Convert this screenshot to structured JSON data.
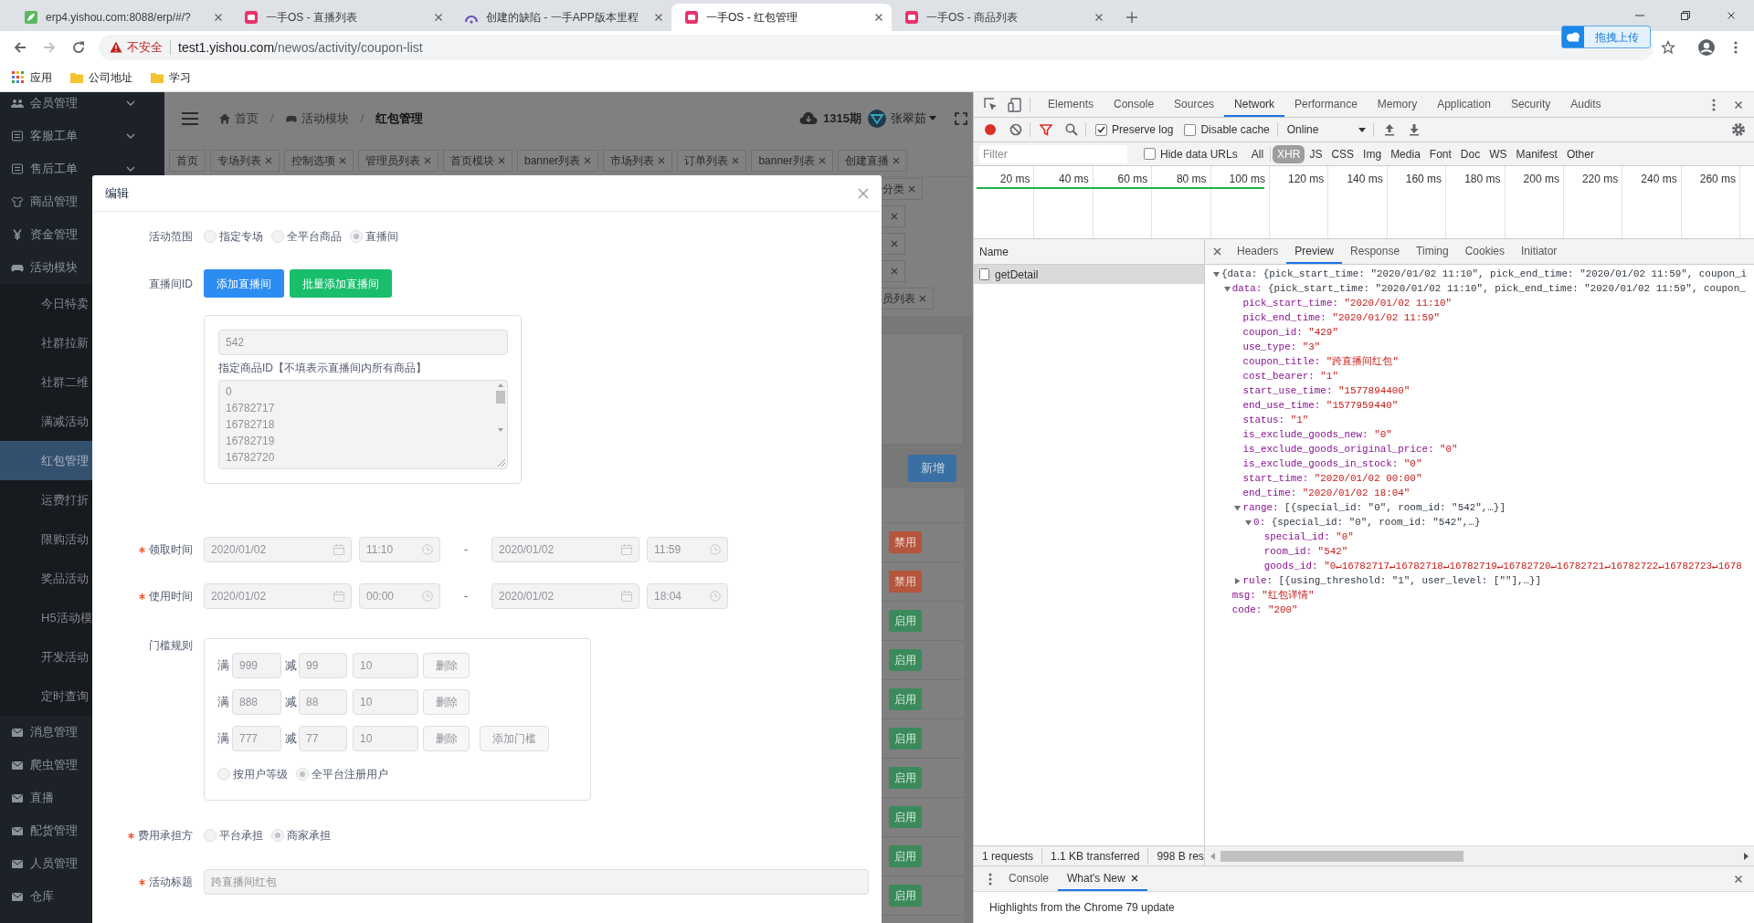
{
  "browser": {
    "tabs": [
      {
        "title": "erp4.yishou.com:8088/erp/#/?",
        "selected": false
      },
      {
        "title": "一手OS - 直播列表",
        "selected": false
      },
      {
        "title": "创建的缺陷 - 一手APP版本里程",
        "selected": false
      },
      {
        "title": "一手OS - 红包管理",
        "selected": true
      },
      {
        "title": "一手OS - 商品列表",
        "selected": false
      }
    ],
    "address": {
      "security": "不安全",
      "host": "test1.yishou.com",
      "path": "/newos/activity/coupon-list"
    },
    "upload_widget": "拖拽上传",
    "bookmarks": [
      {
        "label": "应用",
        "kind": "apps"
      },
      {
        "label": "公司地址",
        "kind": "folder"
      },
      {
        "label": "学习",
        "kind": "folder"
      }
    ]
  },
  "sidebar": {
    "items": [
      {
        "label": "会员管理",
        "expanded": false
      },
      {
        "label": "客服工单",
        "expanded": false
      },
      {
        "label": "售后工单",
        "expanded": false
      },
      {
        "label": "商品管理"
      },
      {
        "label": "资金管理"
      },
      {
        "label": "活动模块",
        "expanded": true,
        "children": [
          {
            "label": "今日特卖",
            "selected": false
          },
          {
            "label": "社群拉新",
            "selected": false
          },
          {
            "label": "社群二维",
            "selected": false
          },
          {
            "label": "满减活动",
            "selected": false
          },
          {
            "label": "红包管理",
            "selected": true
          },
          {
            "label": "运费打折",
            "selected": false
          },
          {
            "label": "限购活动",
            "selected": false
          },
          {
            "label": "奖品活动",
            "selected": false
          },
          {
            "label": "H5活动模",
            "selected": false
          },
          {
            "label": "开发活动",
            "selected": false
          },
          {
            "label": "定时查询",
            "selected": false
          }
        ]
      },
      {
        "label": "消息管理"
      },
      {
        "label": "爬虫管理"
      },
      {
        "label": "直播"
      },
      {
        "label": "配货管理"
      },
      {
        "label": "人员管理"
      },
      {
        "label": "仓库"
      }
    ]
  },
  "header": {
    "breadcrumb": [
      {
        "label": "首页",
        "separator": "/"
      },
      {
        "label": "活动模块",
        "separator": "/"
      },
      {
        "label": "红包管理"
      }
    ],
    "period": "1315期",
    "user": "张翠茹"
  },
  "tags": [
    {
      "label": "首页",
      "closable": false
    },
    {
      "label": "专场列表",
      "closable": true
    },
    {
      "label": "控制选项",
      "closable": true
    },
    {
      "label": "管理员列表",
      "closable": true
    },
    {
      "label": "首页模块",
      "closable": true
    },
    {
      "label": "banner列表",
      "closable": true
    },
    {
      "label": "市场列表",
      "closable": true
    },
    {
      "label": "订单列表",
      "closable": true
    },
    {
      "label": "banner列表",
      "closable": true
    },
    {
      "label": "创建直播",
      "closable": true
    }
  ],
  "tag_fragments": [
    {
      "label": "分类",
      "closable": true
    },
    {
      "closable": true
    },
    {
      "closable": true
    },
    {
      "closable": true
    },
    {
      "label": "员列表",
      "closable": true
    }
  ],
  "new_button": "新增",
  "status_buttons": [
    {
      "label": "禁用",
      "kind": "disable"
    },
    {
      "label": "禁用",
      "kind": "disable"
    },
    {
      "label": "启用",
      "kind": "enable"
    },
    {
      "label": "启用",
      "kind": "enable"
    },
    {
      "label": "启用",
      "kind": "enable"
    },
    {
      "label": "启用",
      "kind": "enable"
    },
    {
      "label": "启用",
      "kind": "enable"
    },
    {
      "label": "启用",
      "kind": "enable"
    },
    {
      "label": "启用",
      "kind": "enable"
    },
    {
      "label": "启用",
      "kind": "enable"
    }
  ],
  "modal": {
    "title": "编辑",
    "scope": {
      "label": "活动范围",
      "options": [
        {
          "label": "指定专场",
          "selected": false
        },
        {
          "label": "全平台商品",
          "selected": false
        },
        {
          "label": "直播间",
          "selected": true
        }
      ]
    },
    "room": {
      "label": "直播间ID",
      "buttons": [
        {
          "label": "添加直播间",
          "kind": "primary"
        },
        {
          "label": "批量添加直播间",
          "kind": "success"
        }
      ],
      "room_id": "542",
      "goods_hint": "指定商品ID【不填表示直播间内所有商品】",
      "goods_ids": [
        "0",
        "16782717",
        "16782718",
        "16782719",
        "16782720"
      ]
    },
    "pick_time": {
      "label": "领取时间",
      "required": true,
      "start_date": "2020/01/02",
      "start_time": "11:10",
      "separator": "-",
      "end_date": "2020/01/02",
      "end_time": "11:59"
    },
    "use_time": {
      "label": "使用时间",
      "required": true,
      "start_date": "2020/01/02",
      "start_time": "00:00",
      "separator": "-",
      "end_date": "2020/01/02",
      "end_time": "18:04"
    },
    "threshold": {
      "label": "门槛规则",
      "rows": [
        {
          "full_label": "满",
          "full": "999",
          "minus_label": "减",
          "minus": "99",
          "count": "10",
          "delete": "删除"
        },
        {
          "full_label": "满",
          "full": "888",
          "minus_label": "减",
          "minus": "88",
          "count": "10",
          "delete": "删除"
        },
        {
          "full_label": "满",
          "full": "777",
          "minus_label": "减",
          "minus": "77",
          "count": "10",
          "delete": "删除"
        }
      ],
      "add_button": "添加门槛",
      "levels": [
        {
          "label": "按用户等级",
          "selected": false
        },
        {
          "label": "全平台注册用户",
          "selected": true
        }
      ]
    },
    "cost_bearer": {
      "label": "费用承担方",
      "required": true,
      "options": [
        {
          "label": "平台承担",
          "selected": false
        },
        {
          "label": "商家承担",
          "selected": true
        }
      ]
    },
    "activity_title": {
      "label": "活动标题",
      "required": true,
      "value": "跨直播间红包"
    }
  },
  "devtools": {
    "panel_tabs": [
      {
        "label": "Elements",
        "selected": false
      },
      {
        "label": "Console",
        "selected": false
      },
      {
        "label": "Sources",
        "selected": false
      },
      {
        "label": "Network",
        "selected": true
      },
      {
        "label": "Performance",
        "selected": false
      },
      {
        "label": "Memory",
        "selected": false
      },
      {
        "label": "Application",
        "selected": false
      },
      {
        "label": "Security",
        "selected": false
      },
      {
        "label": "Audits",
        "selected": false
      }
    ],
    "preserve_log": {
      "label": "Preserve log",
      "checked": true
    },
    "disable_cache": {
      "label": "Disable cache",
      "checked": false
    },
    "throttling": "Online",
    "filter_placeholder": "Filter",
    "hide_data_urls": {
      "label": "Hide data URLs",
      "checked": false
    },
    "type_filters": [
      {
        "label": "All",
        "selected": false
      },
      {
        "label": "XHR",
        "selected": true
      },
      {
        "label": "JS",
        "selected": false
      },
      {
        "label": "CSS",
        "selected": false
      },
      {
        "label": "Img",
        "selected": false
      },
      {
        "label": "Media",
        "selected": false
      },
      {
        "label": "Font",
        "selected": false
      },
      {
        "label": "Doc",
        "selected": false
      },
      {
        "label": "WS",
        "selected": false
      },
      {
        "label": "Manifest",
        "selected": false
      },
      {
        "label": "Other",
        "selected": false
      }
    ],
    "timeline_ticks": [
      "20 ms",
      "40 ms",
      "60 ms",
      "80 ms",
      "100 ms",
      "120 ms",
      "140 ms",
      "160 ms",
      "180 ms",
      "200 ms",
      "220 ms",
      "240 ms",
      "260 ms"
    ],
    "name_column": "Name",
    "requests": [
      {
        "name": "getDetail",
        "selected": true
      }
    ],
    "detail_tabs": [
      {
        "label": "Headers",
        "selected": false
      },
      {
        "label": "Preview",
        "selected": true
      },
      {
        "label": "Response",
        "selected": false
      },
      {
        "label": "Timing",
        "selected": false
      },
      {
        "label": "Cookies",
        "selected": false
      },
      {
        "label": "Initiator",
        "selected": false
      }
    ],
    "preview": [
      {
        "value": "{data: {pick_start_time: \"2020/01/02 11:10\", pick_end_time: \"2020/01/02 11:59\", coupon_i",
        "kind": "object",
        "expanded": true,
        "children": [
          {
            "key": "data:",
            "value": "{pick_start_time: \"2020/01/02 11:10\", pick_end_time: \"2020/01/02 11:59\", coupon_",
            "kind": "object",
            "expanded": true,
            "children": [
              {
                "key": "pick_start_time:",
                "value": "\"2020/01/02 11:10\"",
                "kind": "string"
              },
              {
                "key": "pick_end_time:",
                "value": "\"2020/01/02 11:59\"",
                "kind": "string"
              },
              {
                "key": "coupon_id:",
                "value": "\"429\"",
                "kind": "string"
              },
              {
                "key": "use_type:",
                "value": "\"3\"",
                "kind": "string"
              },
              {
                "key": "coupon_title:",
                "value": "\"跨直播间红包\"",
                "kind": "string"
              },
              {
                "key": "cost_bearer:",
                "value": "\"1\"",
                "kind": "string"
              },
              {
                "key": "start_use_time:",
                "value": "\"1577894400\"",
                "kind": "string"
              },
              {
                "key": "end_use_time:",
                "value": "\"1577959440\"",
                "kind": "string"
              },
              {
                "key": "status:",
                "value": "\"1\"",
                "kind": "string"
              },
              {
                "key": "is_exclude_goods_new:",
                "value": "\"0\"",
                "kind": "string"
              },
              {
                "key": "is_exclude_goods_original_price:",
                "value": "\"0\"",
                "kind": "string"
              },
              {
                "key": "is_exclude_goods_in_stock:",
                "value": "\"0\"",
                "kind": "string"
              },
              {
                "key": "start_time:",
                "value": "\"2020/01/02 00:00\"",
                "kind": "string"
              },
              {
                "key": "end_time:",
                "value": "\"2020/01/02 18:04\"",
                "kind": "string"
              },
              {
                "key": "range:",
                "value": "[{special_id: \"0\", room_id: \"542\",…}]",
                "kind": "object",
                "expanded": true,
                "children": [
                  {
                    "key": "0:",
                    "value": "{special_id: \"0\", room_id: \"542\",…}",
                    "kind": "object",
                    "expanded": true,
                    "children": [
                      {
                        "key": "special_id:",
                        "value": "\"0\"",
                        "kind": "string"
                      },
                      {
                        "key": "room_id:",
                        "value": "\"542\"",
                        "kind": "string"
                      },
                      {
                        "key": "goods_id:",
                        "value": "\"0↵16782717↵16782718↵16782719↵16782720↵16782721↵16782722↵16782723↵1678",
                        "kind": "string"
                      }
                    ]
                  }
                ]
              },
              {
                "key": "rule:",
                "value": "[{using_threshold: \"1\", user_level: [\"\"],…}]",
                "kind": "object",
                "expanded": false
              }
            ]
          },
          {
            "key": "msg:",
            "value": "\"红包详情\"",
            "kind": "string"
          },
          {
            "key": "code:",
            "value": "\"200\"",
            "kind": "string"
          }
        ]
      }
    ],
    "summary": [
      "1 requests",
      "1.1 KB transferred",
      "998 B res"
    ],
    "drawer_tabs": [
      {
        "label": "Console",
        "selected": false,
        "closable": false
      },
      {
        "label": "What's New",
        "selected": true,
        "closable": true
      }
    ],
    "drawer_text": "Highlights from the Chrome 79 update"
  }
}
